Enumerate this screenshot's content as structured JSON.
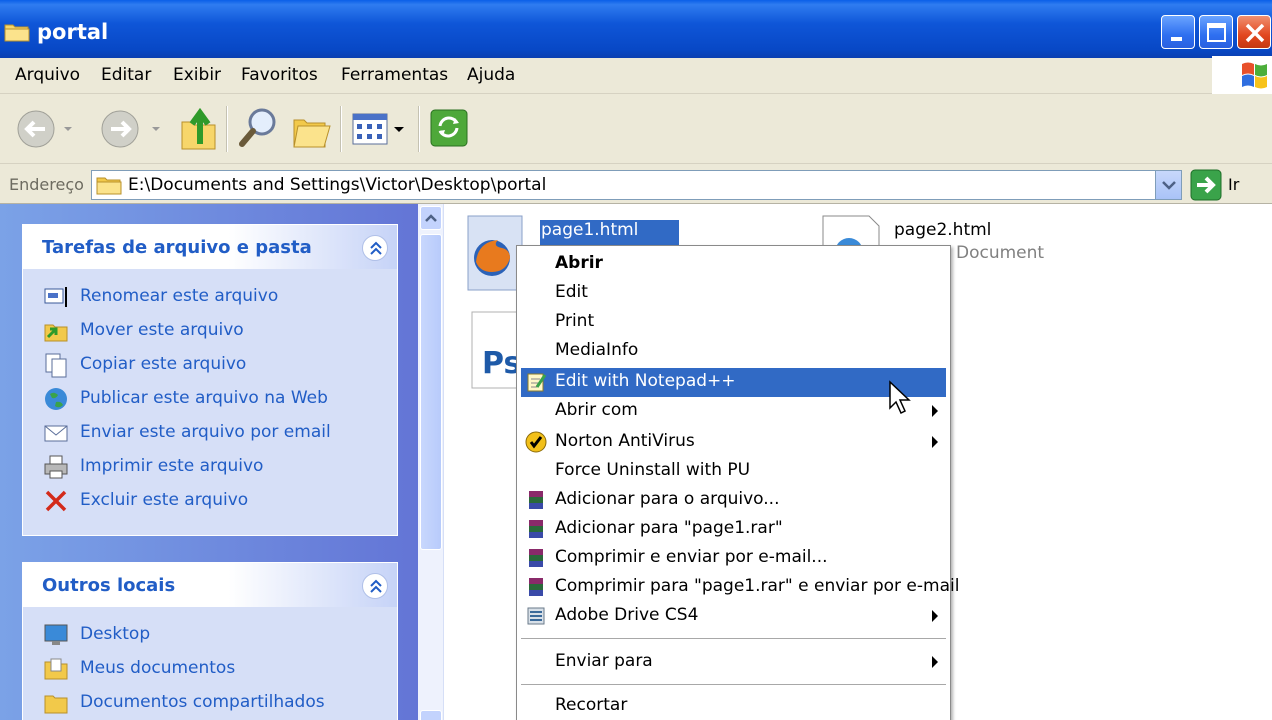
{
  "window": {
    "title": "portal",
    "accent": "#0a4fd4"
  },
  "menu": [
    "Arquivo",
    "Editar",
    "Exibir",
    "Favoritos",
    "Ferramentas",
    "Ajuda"
  ],
  "toolbar": {
    "icons": [
      "back-icon",
      "forward-icon",
      "up-folder-icon",
      "search-icon",
      "folders-icon",
      "views-icon",
      "sync-icon"
    ]
  },
  "address": {
    "label": "Endereço",
    "path": "E:\\Documents and Settings\\Victor\\Desktop\\portal",
    "go_label": "Ir"
  },
  "tasks_panel": {
    "title": "Tarefas de arquivo e pasta",
    "items": [
      {
        "label": "Renomear este arquivo",
        "icon": "rename-icon"
      },
      {
        "label": "Mover este arquivo",
        "icon": "move-icon"
      },
      {
        "label": "Copiar este arquivo",
        "icon": "copy-icon"
      },
      {
        "label": "Publicar este arquivo na Web",
        "icon": "globe-icon"
      },
      {
        "label": "Enviar este arquivo por email",
        "icon": "email-icon"
      },
      {
        "label": "Imprimir este arquivo",
        "icon": "printer-icon"
      },
      {
        "label": "Excluir este arquivo",
        "icon": "delete-icon"
      }
    ]
  },
  "places_panel": {
    "title": "Outros locais",
    "items": [
      {
        "label": "Desktop",
        "icon": "desktop-icon"
      },
      {
        "label": "Meus documentos",
        "icon": "my-documents-icon"
      },
      {
        "label": "Documentos compartilhados",
        "icon": "shared-folder-icon"
      }
    ]
  },
  "files": [
    {
      "name": "page1.html",
      "selected": true,
      "icon": "firefox-html-icon"
    },
    {
      "name": "page2.html",
      "type": "Document",
      "icon": "html-document-icon"
    },
    {
      "name": "",
      "icon": "photoshop-file-icon"
    }
  ],
  "context_menu": {
    "items": [
      {
        "label": "Abrir",
        "bold": true
      },
      {
        "label": "Edit"
      },
      {
        "label": "Print"
      },
      {
        "label": "MediaInfo"
      },
      {
        "label": "Edit with Notepad++",
        "highlighted": true,
        "icon": "notepad-plus-plus-icon"
      },
      {
        "label": "Abrir com",
        "submenu": true
      },
      {
        "label": "Norton AntiVirus",
        "submenu": true,
        "icon": "norton-icon"
      },
      {
        "label": "Force Uninstall with PU"
      },
      {
        "label": "Adicionar para o arquivo...",
        "icon": "winrar-icon"
      },
      {
        "label": "Adicionar para \"page1.rar\"",
        "icon": "winrar-icon"
      },
      {
        "label": "Comprimir e enviar por e-mail...",
        "icon": "winrar-icon"
      },
      {
        "label": "Comprimir para \"page1.rar\" e enviar por e-mail",
        "icon": "winrar-icon"
      },
      {
        "label": "Adobe Drive CS4",
        "submenu": true,
        "icon": "adobe-drive-icon"
      },
      {
        "label": "Enviar para",
        "submenu": true
      },
      {
        "label": "Recortar"
      }
    ]
  }
}
